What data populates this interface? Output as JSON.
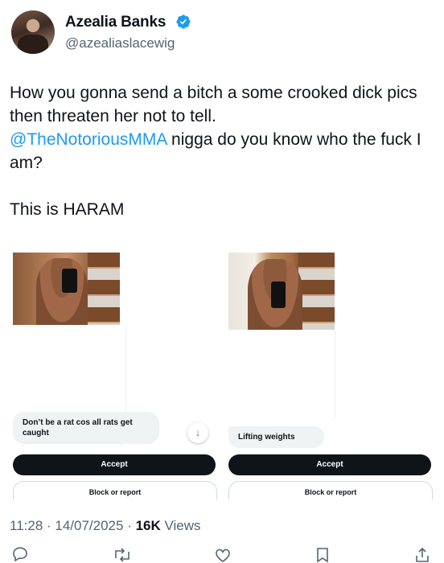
{
  "author": {
    "display_name": "Azealia Banks",
    "handle": "@azealiaslacewig",
    "verified_color": "#1d9bf0"
  },
  "tweet": {
    "line1": "How you gonna send a bitch a some crooked dick pics then threaten her not to tell.",
    "mention": "@TheNotoriousMMA",
    "line2_rest": " nigga do you know who the fuck I am?",
    "line3": "This is HARAM"
  },
  "screenshots": [
    {
      "bubble_text": "Don’t be a rat cos all rats get caught",
      "accept_label": "Accept",
      "block_label": "Block or report",
      "arrow_icon": "arrow-down-icon"
    },
    {
      "bubble_text": "Lifting weights",
      "accept_label": "Accept",
      "block_label": "Block or report"
    }
  ],
  "meta": {
    "time_date": "11:28 · 14/07/2025 · ",
    "views_count": "16K",
    "views_label": " Views"
  },
  "actions": [
    "reply-icon",
    "retweet-icon",
    "like-icon",
    "bookmark-icon",
    "share-icon"
  ]
}
